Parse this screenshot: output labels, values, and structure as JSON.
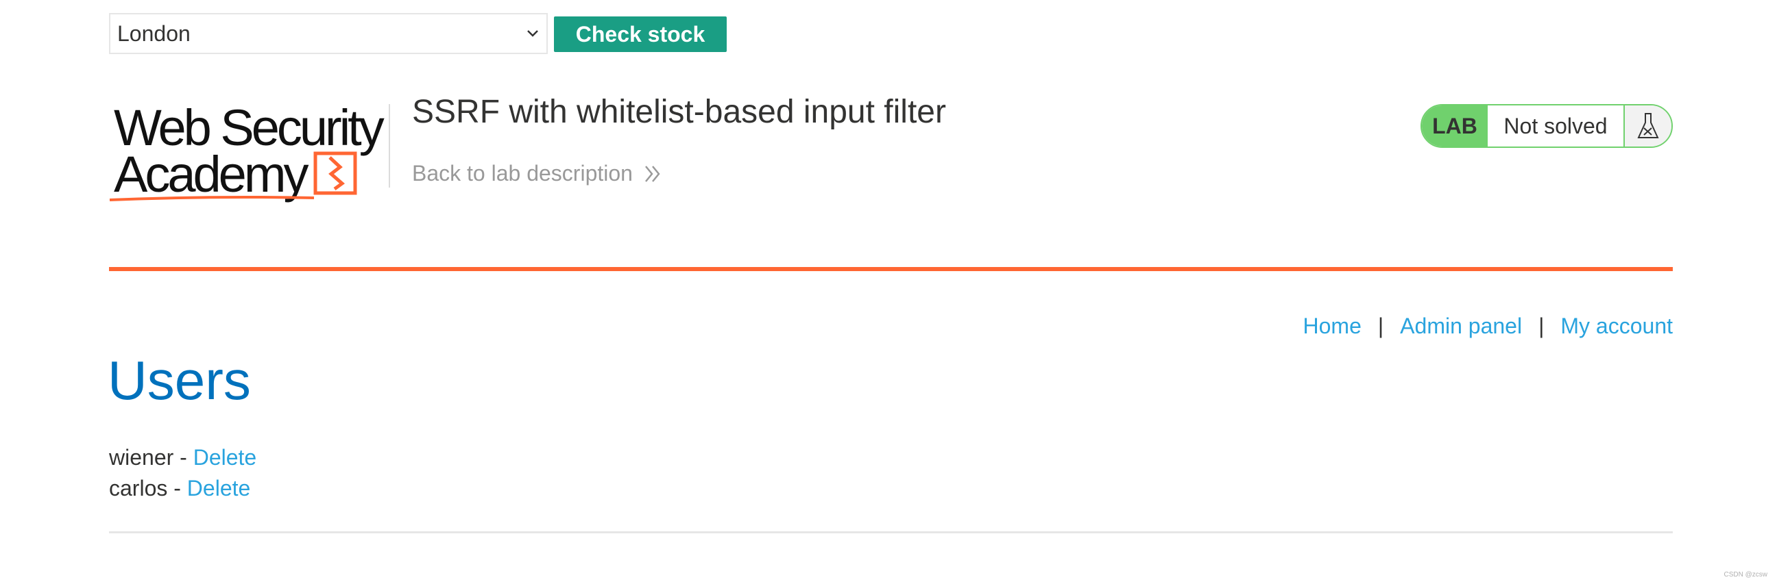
{
  "stock_form": {
    "selected_location": "London",
    "check_button_label": "Check stock"
  },
  "header": {
    "logo_line1": "Web Security",
    "logo_line2": "Academy",
    "lab_title": "SSRF with whitelist-based input filter",
    "back_link_label": "Back to lab description",
    "lab_badge_label": "LAB",
    "lab_status": "Not solved"
  },
  "nav": {
    "home": "Home",
    "admin_panel": "Admin panel",
    "my_account": "My account",
    "separator": "|"
  },
  "main": {
    "heading": "Users",
    "users": [
      {
        "name": "wiener",
        "separator": " - ",
        "action": "Delete"
      },
      {
        "name": "carlos",
        "separator": " - ",
        "action": "Delete"
      }
    ]
  },
  "watermark": "CSDN @zcsw",
  "colors": {
    "check_button": "#1a9e84",
    "accent_orange": "#ff6633",
    "link_blue": "#29a3de",
    "heading_blue": "#0071bc",
    "lab_green": "#70d16d"
  }
}
